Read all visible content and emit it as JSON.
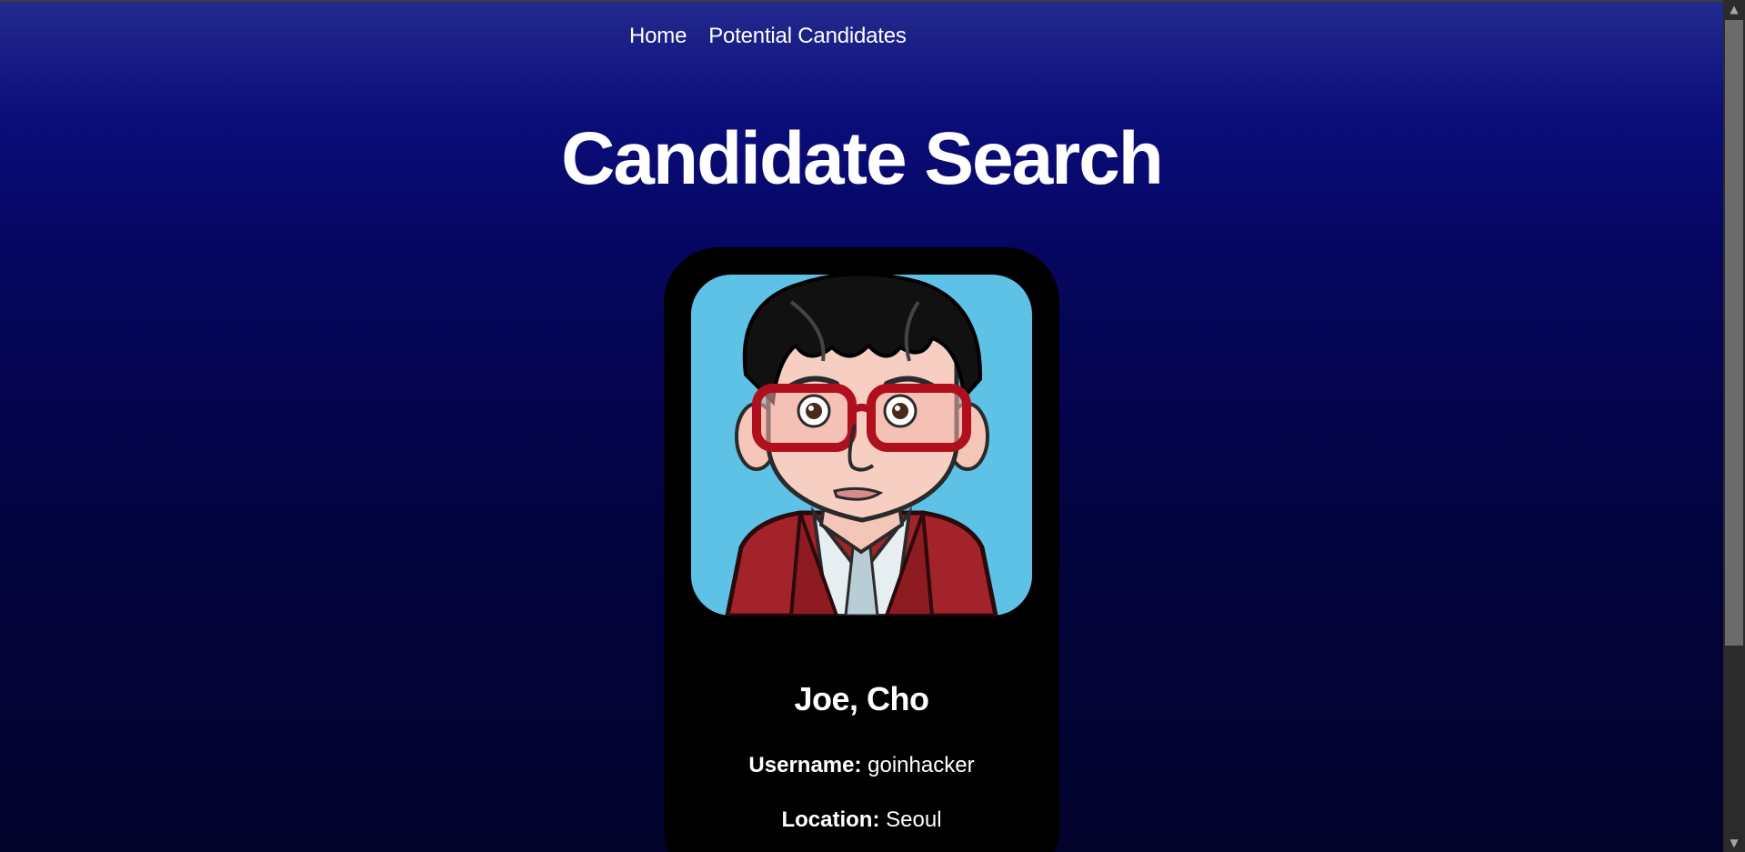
{
  "nav": {
    "home_label": "Home",
    "candidates_label": "Potential Candidates"
  },
  "page": {
    "title": "Candidate Search"
  },
  "candidate": {
    "name": "Joe, Cho",
    "username_label": "Username:",
    "username": "goinhacker",
    "location_label": "Location:",
    "location": "Seoul",
    "avatar_icon": "cartoon-avatar-icon"
  },
  "colors": {
    "background_top": "#232a8e",
    "background_bottom": "#03032c",
    "card": "#000000",
    "avatar_bg": "#5ec2e6",
    "text": "#ffffff"
  },
  "scrollbar": {
    "up_icon": "▲",
    "down_icon": "▼"
  }
}
